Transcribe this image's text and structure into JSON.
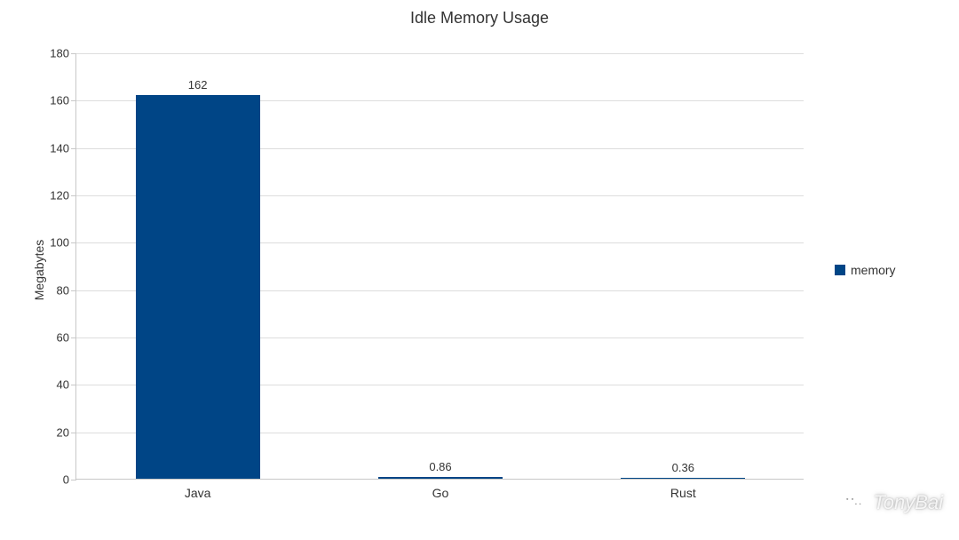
{
  "chart_data": {
    "type": "bar",
    "title": "Idle Memory Usage",
    "xlabel": "",
    "ylabel": "Megabytes",
    "categories": [
      "Java",
      "Go",
      "Rust"
    ],
    "series": [
      {
        "name": "memory",
        "values": [
          162,
          0.86,
          0.36
        ],
        "color": "#004586"
      }
    ],
    "ylim": [
      0,
      180
    ],
    "yticks": [
      0,
      20,
      40,
      60,
      80,
      100,
      120,
      140,
      160,
      180
    ],
    "data_labels": [
      "162",
      "0.86",
      "0.36"
    ]
  },
  "legend": {
    "label": "memory"
  },
  "watermark": {
    "text": "TonyBai"
  }
}
